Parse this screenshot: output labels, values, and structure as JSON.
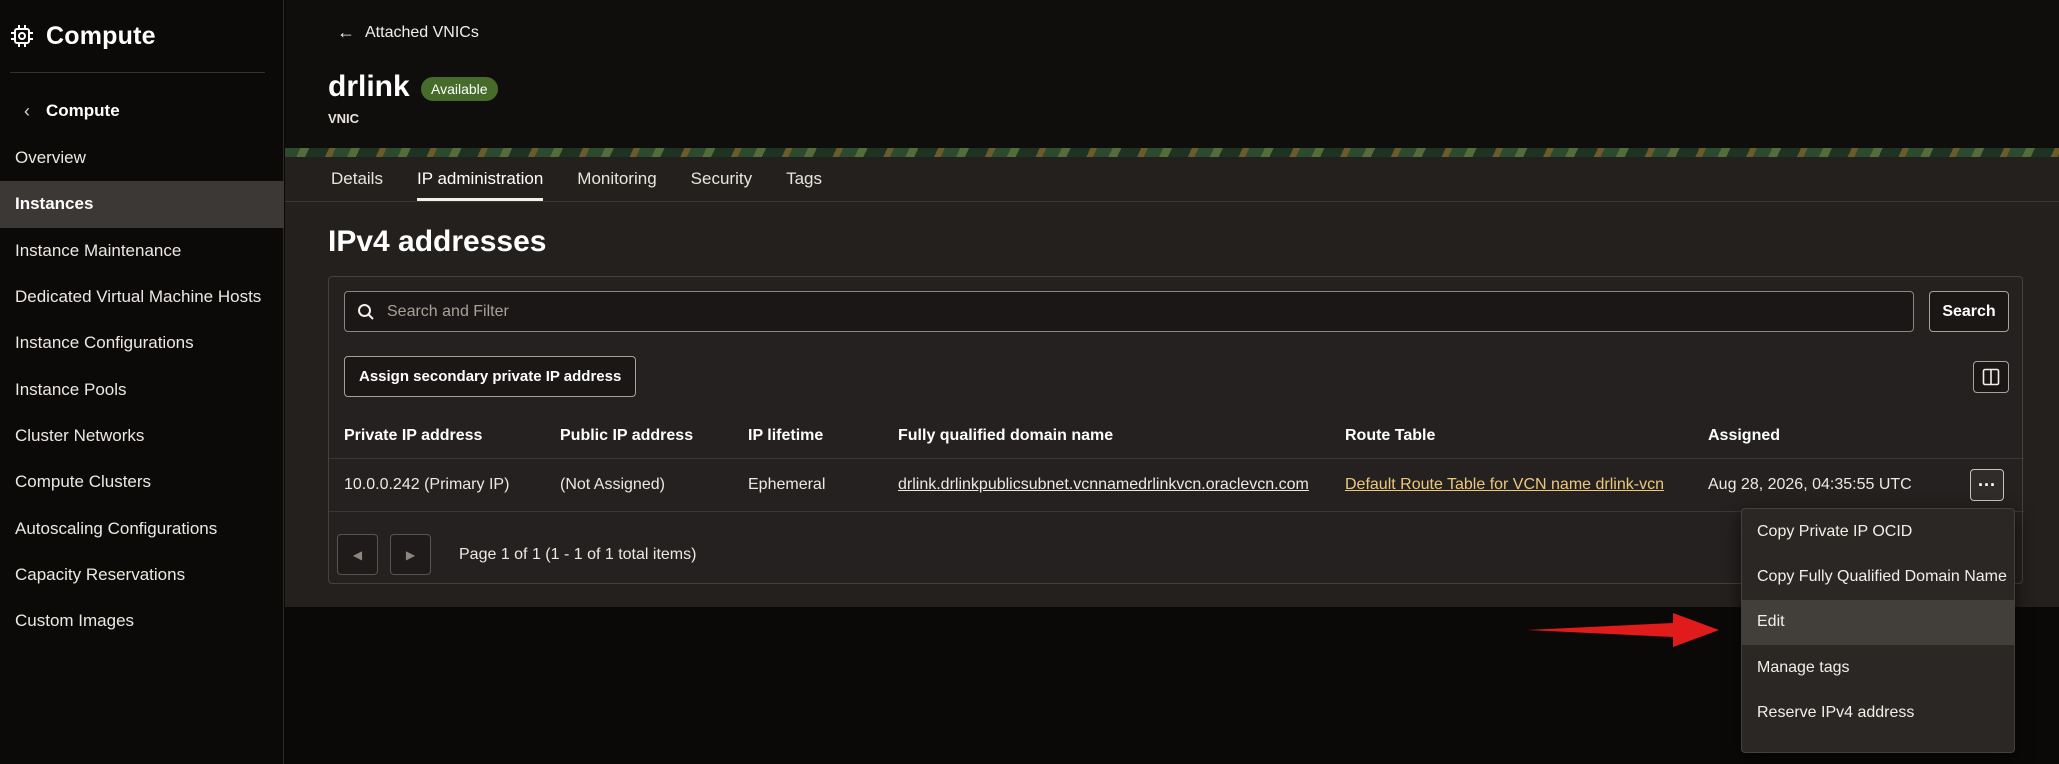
{
  "sidebar": {
    "title": "Compute",
    "back_label": "Compute",
    "items": [
      {
        "label": "Overview"
      },
      {
        "label": "Instances"
      },
      {
        "label": "Instance Maintenance"
      },
      {
        "label": "Dedicated Virtual Machine Hosts"
      },
      {
        "label": "Instance Configurations"
      },
      {
        "label": "Instance Pools"
      },
      {
        "label": "Cluster Networks"
      },
      {
        "label": "Compute Clusters"
      },
      {
        "label": "Autoscaling Configurations"
      },
      {
        "label": "Capacity Reservations"
      },
      {
        "label": "Custom Images"
      }
    ],
    "active_item": "Instances"
  },
  "header": {
    "back_label": "Attached VNICs",
    "title": "drlink",
    "status": "Available",
    "subtitle": "VNIC"
  },
  "tabs": [
    {
      "label": "Details"
    },
    {
      "label": "IP administration"
    },
    {
      "label": "Monitoring"
    },
    {
      "label": "Security"
    },
    {
      "label": "Tags"
    }
  ],
  "active_tab": "IP administration",
  "section": {
    "title": "IPv4 addresses",
    "search_placeholder": "Search and Filter",
    "search_button": "Search",
    "assign_button": "Assign secondary private IP address"
  },
  "table": {
    "columns": [
      "Private IP address",
      "Public IP address",
      "IP lifetime",
      "Fully qualified domain name",
      "Route Table",
      "Assigned"
    ],
    "rows": [
      {
        "private_ip": "10.0.0.242 (Primary IP)",
        "public_ip": "(Not Assigned)",
        "lifetime": "Ephemeral",
        "fqdn": "drlink.drlinkpublicsubnet.vcnnamedrlinkvcn.oraclevcn.com",
        "route_table": "Default Route Table for VCN name drlink-vcn",
        "assigned": "Aug 28, 2026, 04:35:55 UTC"
      }
    ],
    "pagination": "Page 1 of 1 (1 - 1 of 1 total items)"
  },
  "actions_menu": {
    "items": [
      {
        "label": "Copy Private IP OCID"
      },
      {
        "label": "Copy Fully Qualified Domain Name"
      },
      {
        "label": "Edit"
      },
      {
        "label": "Manage tags"
      },
      {
        "label": "Reserve IPv4 address"
      }
    ],
    "highlighted": "Edit"
  },
  "colors": {
    "badge_green": "#466b2a",
    "link_gold": "#ecc97a",
    "annotation_red": "#e01b1b"
  }
}
